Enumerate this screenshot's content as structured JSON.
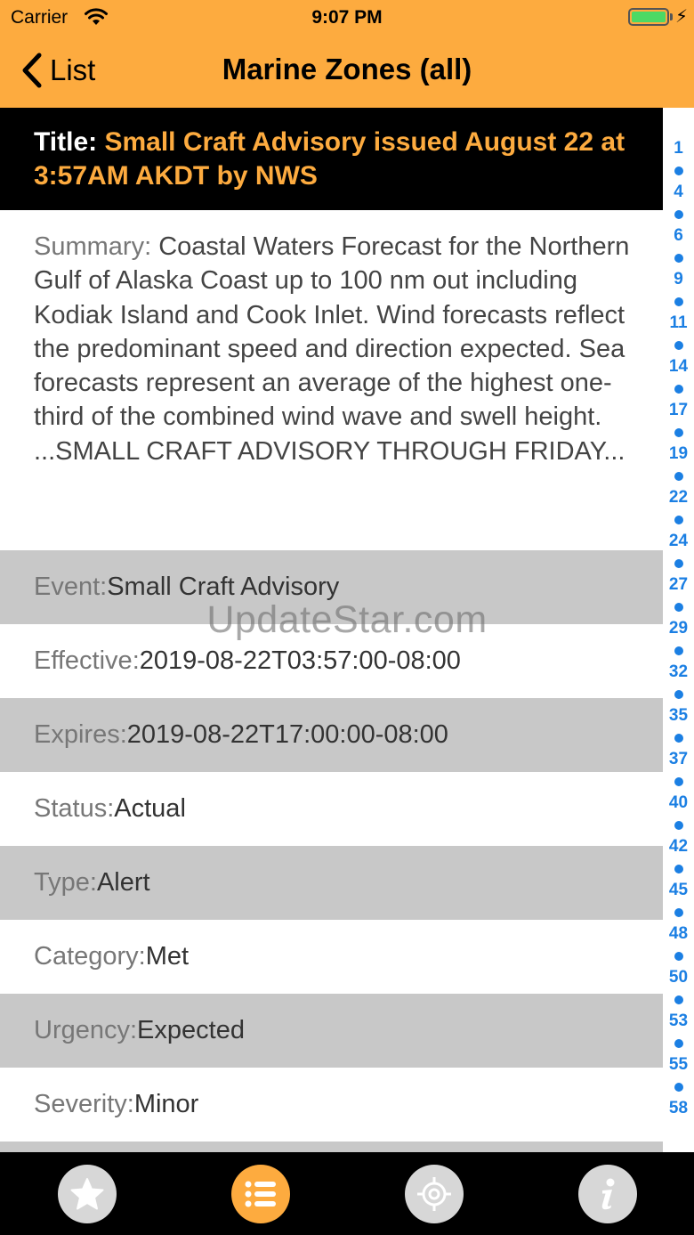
{
  "status_bar": {
    "carrier": "Carrier",
    "time": "9:07 PM"
  },
  "nav": {
    "back_label": "List",
    "title": "Marine Zones (all)"
  },
  "alert": {
    "title_label": "Title: ",
    "title_value": "Small Craft Advisory issued August 22 at 3:57AM AKDT by NWS",
    "summary_label": "Summary: ",
    "summary_value": "Coastal Waters Forecast for the Northern Gulf of Alaska Coast up to 100 nm out including Kodiak Island and Cook Inlet. Wind forecasts reflect the predominant speed and direction expected. Sea forecasts represent an average of the highest one-third of the combined wind wave and swell height. ...SMALL CRAFT ADVISORY THROUGH FRIDAY...",
    "fields": [
      {
        "label": "Event: ",
        "value": "Small Craft Advisory"
      },
      {
        "label": "Effective: ",
        "value": "2019-08-22T03:57:00-08:00"
      },
      {
        "label": "Expires: ",
        "value": "2019-08-22T17:00:00-08:00"
      },
      {
        "label": "Status: ",
        "value": "Actual"
      },
      {
        "label": "Type: ",
        "value": "Alert"
      },
      {
        "label": "Category: ",
        "value": "Met"
      },
      {
        "label": "Urgency: ",
        "value": "Expected"
      },
      {
        "label": "Severity: ",
        "value": "Minor"
      }
    ]
  },
  "watermark": "UpdateStar.com",
  "section_index": [
    "1",
    "4",
    "6",
    "9",
    "11",
    "14",
    "17",
    "19",
    "22",
    "24",
    "27",
    "29",
    "32",
    "35",
    "37",
    "40",
    "42",
    "45",
    "48",
    "50",
    "53",
    "55",
    "58"
  ],
  "tabs": [
    {
      "icon": "star-icon",
      "active": false
    },
    {
      "icon": "list-icon",
      "active": true
    },
    {
      "icon": "target-icon",
      "active": false
    },
    {
      "icon": "info-icon",
      "active": false
    }
  ],
  "colors": {
    "accent": "#FDAB3F",
    "index_blue": "#1B7FE3",
    "row_gray": "#C8C8C8",
    "tab_inactive": "#D7D7D7"
  }
}
